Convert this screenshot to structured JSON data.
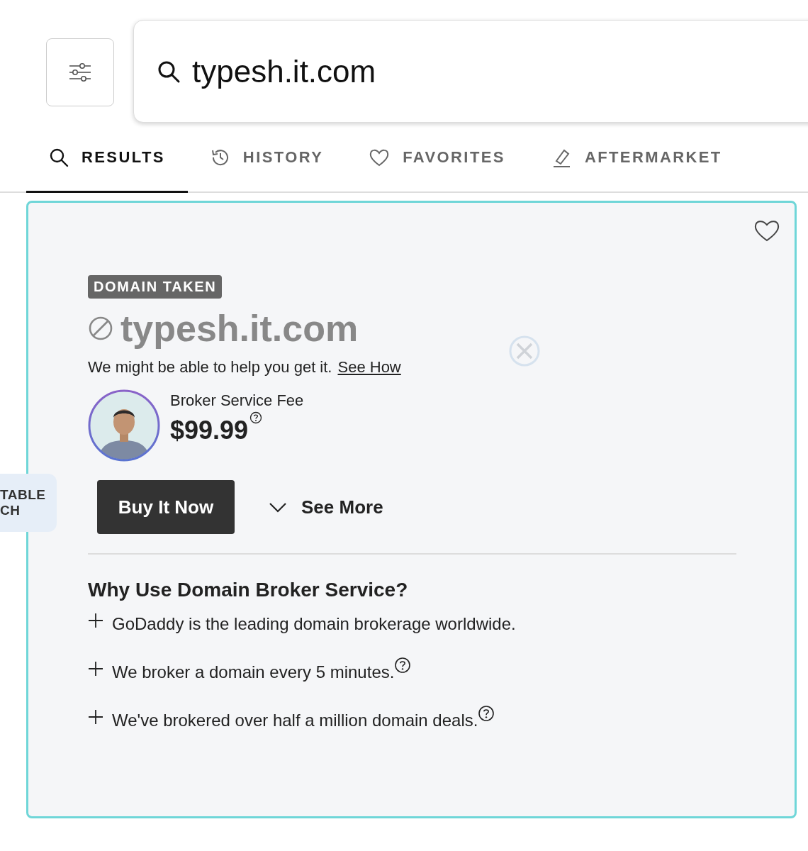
{
  "search": {
    "value": "typesh.it.com"
  },
  "tabs": [
    {
      "label": "RESULTS",
      "selected": true
    },
    {
      "label": "HISTORY",
      "selected": false
    },
    {
      "label": "FAVORITES",
      "selected": false
    },
    {
      "label": "AFTERMARKET",
      "selected": false
    }
  ],
  "side_tab": {
    "lines": [
      "TABLE",
      "CH"
    ]
  },
  "result": {
    "favorite": false,
    "badge": "DOMAIN TAKEN",
    "domain": "typesh.it.com",
    "message": "We might be able to help you get it.",
    "link": "See How",
    "fee_label": "Broker Service Fee",
    "price": "$99.99",
    "price_help": true,
    "buy_button": "Buy It Now",
    "see_more": "See More",
    "expanded": false
  },
  "why": {
    "title": "Why Use Domain Broker Service?",
    "items": [
      {
        "text": "GoDaddy is the leading domain brokerage worldwide.",
        "help": false
      },
      {
        "text": "We broker a domain every 5 minutes.",
        "help": true
      },
      {
        "text": "We've brokered over half a million domain deals.",
        "help": true
      }
    ]
  }
}
